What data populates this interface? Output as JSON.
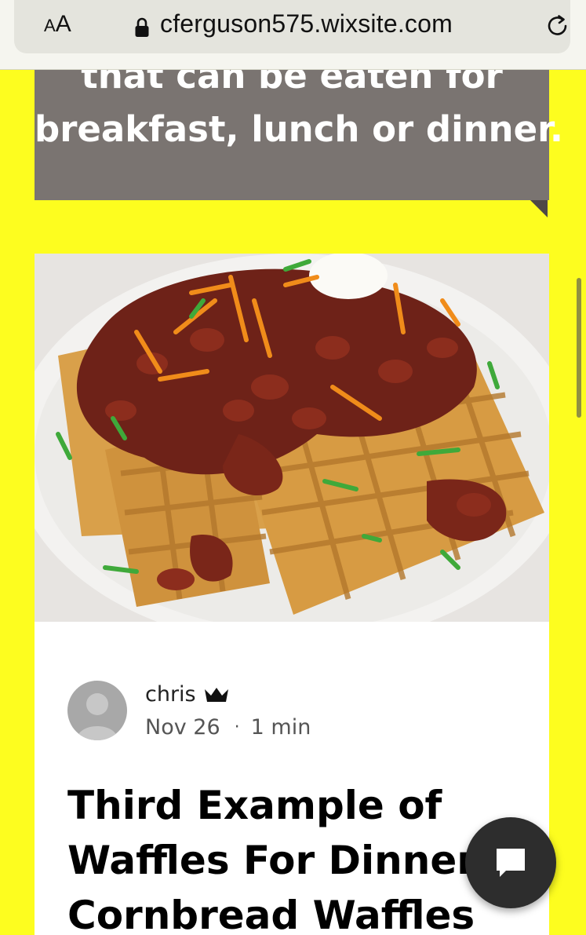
{
  "browser": {
    "text_size_small": "A",
    "text_size_big": "A",
    "url": "cferguson575.wixsite.com"
  },
  "tagline": {
    "line1": "that can be eaten for",
    "line2": "breakfast, lunch or dinner."
  },
  "post": {
    "image_alt": "Cornbread waffles topped with chili, shredded cheese, green onions and sour cream on a white plate",
    "author": "chris",
    "date": "Nov 26",
    "separator": "·",
    "read_time": "1 min",
    "title_lines": [
      "Third Example of",
      "Waffles For Dinner:",
      "Cornbread Waffles"
    ]
  },
  "colors": {
    "page_background": "#fdfd1f",
    "tagline_background": "#7a7471",
    "chat_button": "#2d2d2d"
  },
  "icons": {
    "lock": "lock-icon",
    "reload": "reload-icon",
    "crown": "crown-icon",
    "chat": "chat-icon",
    "avatar": "user-silhouette-icon"
  }
}
